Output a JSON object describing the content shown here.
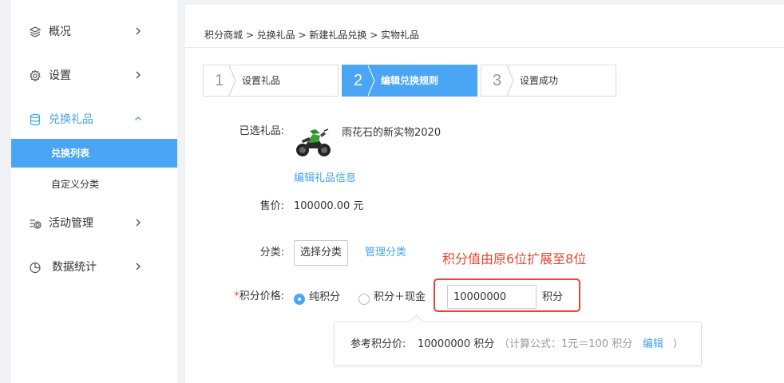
{
  "sidebar": {
    "items": [
      {
        "label": "概况",
        "icon": "layers-icon"
      },
      {
        "label": "设置",
        "icon": "gear-icon"
      },
      {
        "label": "兑换礼品",
        "icon": "database-icon"
      },
      {
        "label": "活动管理",
        "icon": "activity-settings-icon"
      },
      {
        "label": "数据统计",
        "icon": "pie-chart-icon"
      }
    ],
    "sub_items": [
      {
        "label": "兑换列表"
      },
      {
        "label": "自定义分类"
      }
    ]
  },
  "breadcrumb": "积分商城 > 兑换礼品 > 新建礼品兑换 > 实物礼品",
  "steps": [
    {
      "number": "1",
      "label": "设置礼品"
    },
    {
      "number": "2",
      "label": "编辑兑换规则"
    },
    {
      "number": "3",
      "label": "设置成功"
    }
  ],
  "form": {
    "selected_gift_label": "已选礼品:",
    "gift_name": "雨花石的新实物2020",
    "edit_gift_link": "编辑礼品信息",
    "price_label": "售价:",
    "price_value": "100000.00 元",
    "category_label": "分类:",
    "choose_category_button": "选择分类",
    "manage_category_link": "管理分类",
    "points_price_required_mark": "*",
    "points_price_label": "积分价格:",
    "radio_pure_points": "纯积分",
    "radio_points_cash": "积分＋现金",
    "points_input_value": "10000000",
    "points_unit": "积分"
  },
  "annotation": "积分值由原6位扩展至8位",
  "reference": {
    "label": "参考积分价:",
    "value": "10000000 积分",
    "formula": "（计算公式：1元＝100 积分",
    "edit_link": "编辑",
    "close_paren": "）"
  },
  "colors": {
    "accent": "#4aa6f5",
    "annotation_red": "#e9462f"
  }
}
